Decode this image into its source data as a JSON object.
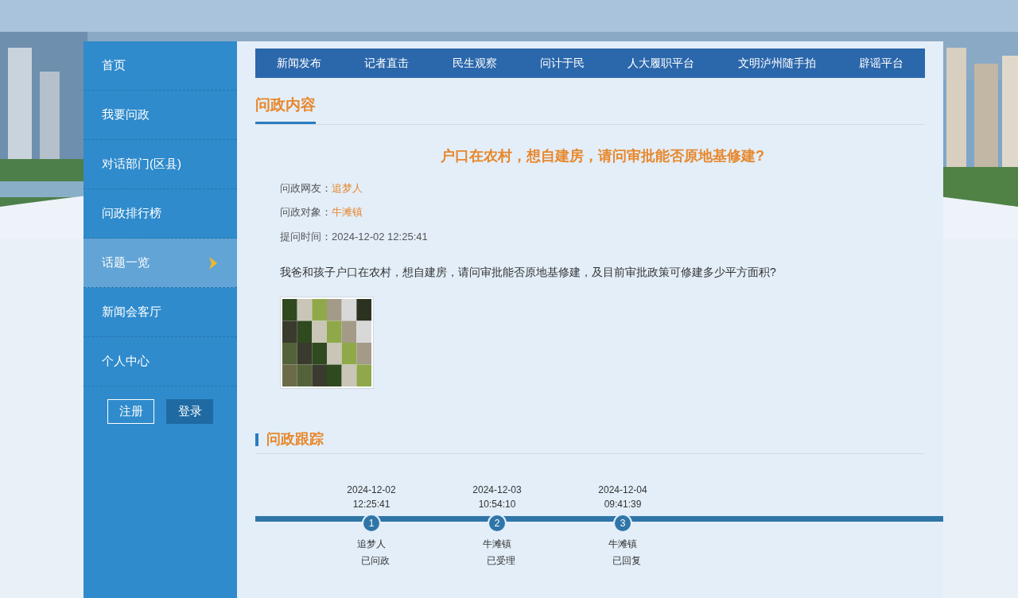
{
  "sidebar": {
    "items": [
      {
        "label": "首页",
        "selected": false
      },
      {
        "label": "我要问政",
        "selected": false
      },
      {
        "label": "对话部门(区县)",
        "selected": false
      },
      {
        "label": "问政排行榜",
        "selected": false
      },
      {
        "label": "话题一览",
        "selected": true
      },
      {
        "label": "新闻会客厅",
        "selected": false
      },
      {
        "label": "个人中心",
        "selected": false
      }
    ],
    "buttons": [
      {
        "label": "注册",
        "kind": "outline"
      },
      {
        "label": "登录",
        "kind": "filled"
      }
    ]
  },
  "nav": {
    "items": [
      "新闻发布",
      "记者直击",
      "民生观察",
      "问计于民",
      "人大履职平台",
      "文明泸州随手拍",
      "辟谣平台"
    ]
  },
  "content": {
    "heading": "问政内容",
    "title": "户口在农村，想自建房，请问审批能否原地基修建?",
    "fields": [
      {
        "label": "问政网友：",
        "value": "追梦人",
        "kind": "link"
      },
      {
        "label": "问政对象：",
        "value": "牛滩镇",
        "kind": "link"
      },
      {
        "label": "提问时间：",
        "value": "2024-12-02 12:25:41",
        "kind": "text"
      }
    ],
    "body": "我爸和孩子户口在农村，想自建房，请问审批能否原地基修建，及目前审批政策可修建多少平方面积?"
  },
  "tracking": {
    "heading": "问政跟踪",
    "steps": [
      {
        "date": "2024-12-02",
        "time": "12:25:41",
        "number": "1",
        "actor": "追梦人",
        "status": "已问政"
      },
      {
        "date": "2024-12-03",
        "time": "10:54:10",
        "number": "2",
        "actor": "牛滩镇",
        "status": "已受理"
      },
      {
        "date": "2024-12-04",
        "time": "09:41:39",
        "number": "3",
        "actor": "牛滩镇",
        "status": "已回复"
      }
    ]
  }
}
